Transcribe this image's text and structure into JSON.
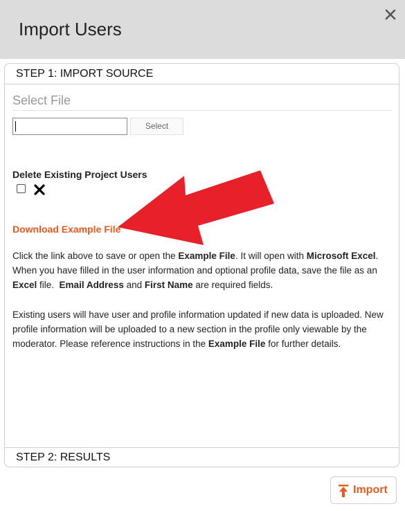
{
  "dialog": {
    "title": "Import Users",
    "close_icon": "close-icon"
  },
  "steps": {
    "step1": "STEP 1: IMPORT SOURCE",
    "step2": "STEP 2: RESULTS"
  },
  "file": {
    "label": "Select File",
    "input_value": "",
    "select_button": "Select"
  },
  "delete_existing": {
    "label": "Delete Existing Project Users",
    "checked": false,
    "clear_icon": "x-icon"
  },
  "download": {
    "link": "Download Example File"
  },
  "instructions": {
    "p1_a": "Click the link above to save or open the ",
    "p1_b": "Example File",
    "p1_c": ". It will open with ",
    "p1_d": "Microsoft Excel",
    "p1_e": ". When you have filled in the user information and optional profile data, save the file as an ",
    "p1_f": "Excel",
    "p1_g": " file.  ",
    "p1_h": "Email Address",
    "p1_i": " and ",
    "p1_j": "First Name",
    "p1_k": " are required fields.",
    "p2_a": "Existing users will have user and profile information updated if new data is uploaded. New profile information will be uploaded to a new section in the profile only viewable by the moderator. Please reference instructions in the ",
    "p2_b": "Example File",
    "p2_c": " for further details."
  },
  "actions": {
    "import_label": "Import",
    "import_icon": "upload-arrow-icon"
  },
  "colors": {
    "accent": "#ea5a1c",
    "header_bg": "#dcdcdc",
    "annotation_arrow": "#e8202a"
  }
}
